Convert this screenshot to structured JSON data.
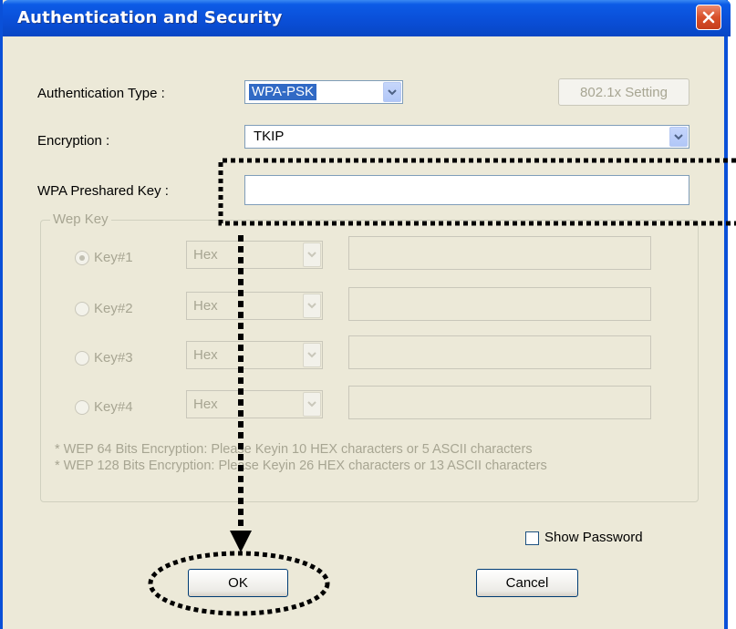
{
  "window": {
    "title": "Authentication and Security",
    "close_icon": "close-icon"
  },
  "auth_type": {
    "label": "Authentication Type :",
    "value": "WPA-PSK",
    "setting_button": "802.1x Setting"
  },
  "encryption": {
    "label": "Encryption :",
    "value": "TKIP"
  },
  "wpa_key": {
    "label": "WPA Preshared Key :",
    "value": ""
  },
  "wep": {
    "group_label": "Wep Key",
    "keys": [
      {
        "label": "Key#1",
        "format": "Hex",
        "value": "",
        "selected": true
      },
      {
        "label": "Key#2",
        "format": "Hex",
        "value": "",
        "selected": false
      },
      {
        "label": "Key#3",
        "format": "Hex",
        "value": "",
        "selected": false
      },
      {
        "label": "Key#4",
        "format": "Hex",
        "value": "",
        "selected": false
      }
    ],
    "notes": [
      "* WEP 64 Bits Encryption:   Please Keyin 10 HEX characters or 5 ASCII characters",
      "* WEP 128 Bits Encryption:   Please Keyin 26 HEX characters or 13 ASCII characters"
    ]
  },
  "show_password": {
    "label": "Show Password",
    "checked": false
  },
  "buttons": {
    "ok": "OK",
    "cancel": "Cancel"
  },
  "colors": {
    "title_bar": "#0a4fd8",
    "dialog_bg": "#ece9d8",
    "selection": "#316ac5",
    "disabled_text": "#a7a592"
  }
}
